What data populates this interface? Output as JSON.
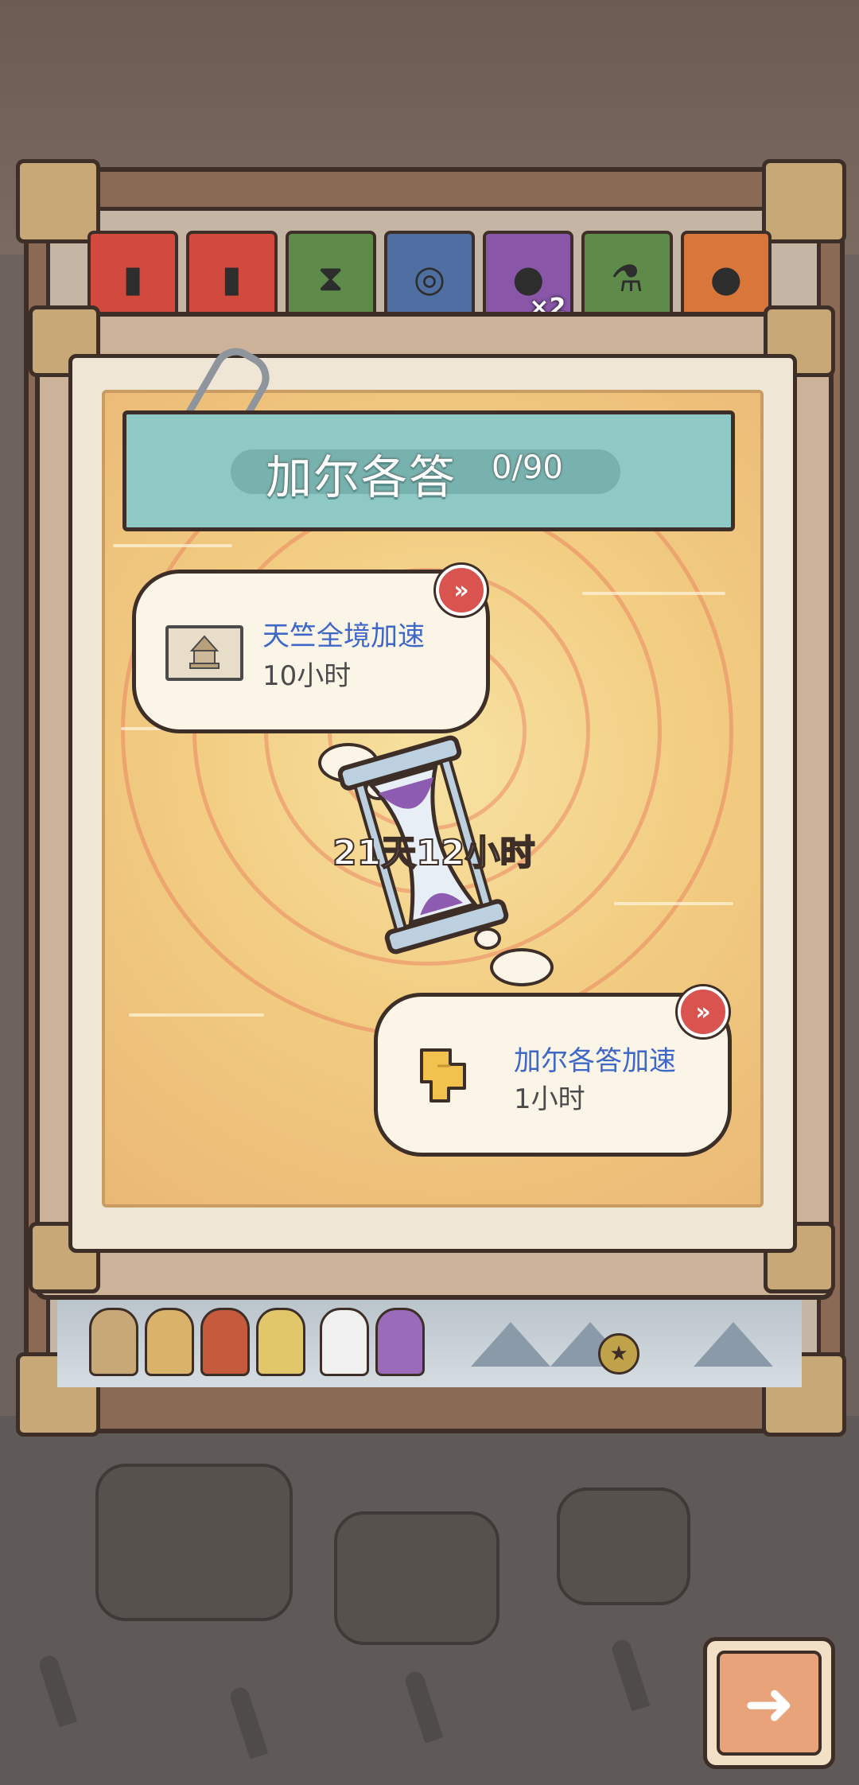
{
  "header": {
    "title": "加尔各答",
    "progress_text": "0/90"
  },
  "items_strip": {
    "tiles": [
      {
        "icon": "battery-icon",
        "color": "#d24a3d"
      },
      {
        "icon": "battery-icon",
        "color": "#d24a3d"
      },
      {
        "icon": "hourglass-icon",
        "color": "#5f8b4a"
      },
      {
        "icon": "target-icon",
        "color": "#4f6fa3"
      },
      {
        "icon": "moon-icon",
        "color": "#8a57a8",
        "badge": "×2"
      },
      {
        "icon": "potion-icon",
        "color": "#5f8b4a"
      },
      {
        "icon": "bomb-icon",
        "color": "#d9773a"
      }
    ]
  },
  "center": {
    "total_time": "21天12小时",
    "icon": "hourglass-icon"
  },
  "boosts": [
    {
      "name": "天竺全境加速",
      "duration": "10小时",
      "icon": "temple-icon"
    },
    {
      "name": "加尔各答加速",
      "duration": "1小时",
      "icon": "puzzle-map-icon"
    }
  ],
  "buttons": {
    "next_icon": "arrow-right-icon",
    "fast_forward_symbol": "»"
  },
  "colors": {
    "accent_teal": "#8fc9c6",
    "name_blue": "#3f67c8",
    "button_red": "#d9534f"
  }
}
